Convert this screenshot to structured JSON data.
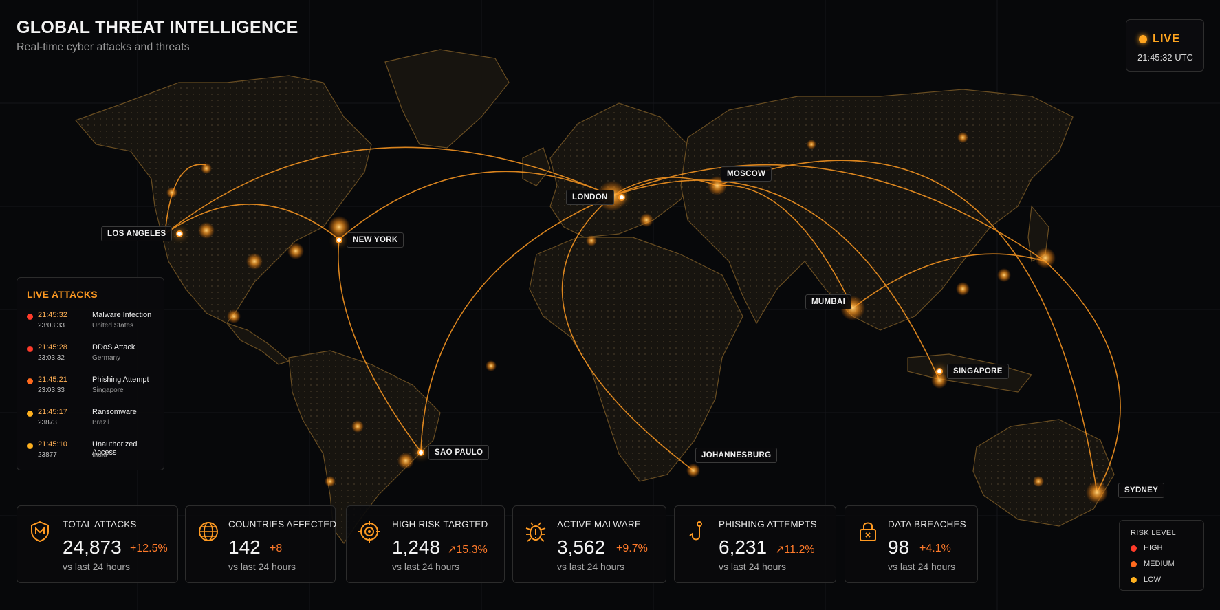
{
  "header": {
    "title": "GLOBAL THREAT INTELLIGENCE",
    "subtitle": "Real-time cyber attacks and threats"
  },
  "status": {
    "label": "LIVE",
    "time": "21:45:32 UTC",
    "color": "#ffa51f"
  },
  "cities": {
    "los_angeles": "LOS ANGELES",
    "new_york": "NEW YORK",
    "london": "LONDON",
    "moscow": "MOSCOW",
    "mumbai": "MUMBAI",
    "singapore": "SINGAPORE",
    "sao_paulo": "SAO PAULO",
    "johannesburg": "JOHANNESBURG",
    "sydney": "SYDNEY"
  },
  "live_attacks": {
    "title": "LIVE ATTACKS",
    "items": [
      {
        "time": "21:45:32",
        "sub": "23:03:33",
        "name": "Malware Infection",
        "location": "United States",
        "color": "#ff3b2a"
      },
      {
        "time": "21:45:28",
        "sub": "23:03:32",
        "name": "DDoS Attack",
        "location": "Germany",
        "color": "#ff3b2a"
      },
      {
        "time": "21:45:21",
        "sub": "23:03:33",
        "name": "Phishing Attempt",
        "location": "Singapore",
        "color": "#ff6a1e"
      },
      {
        "time": "21:45:17",
        "sub": "23873",
        "name": "Ransomware",
        "location": "Brazil",
        "color": "#ffb11f"
      },
      {
        "time": "21:45:10",
        "sub": "23877",
        "name": "Unauthorized Access",
        "location": "India",
        "color": "#ffb11f"
      }
    ]
  },
  "stats": [
    {
      "label": "TOTAL ATTACKS",
      "value": "24,873",
      "change": "+12.5%",
      "note": "vs last 24 hours",
      "icon": "shield-icon"
    },
    {
      "label": "COUNTRIES AFFECTED",
      "value": "142",
      "change": "+8",
      "note": "vs last 24 hours",
      "icon": "globe-icon"
    },
    {
      "label": "HIGH RISK TARGTED",
      "value": "1,248",
      "change": "↗15.3%",
      "note": "vs last 24 hours",
      "icon": "target-icon"
    },
    {
      "label": "ACTIVE MALWARE",
      "value": "3,562",
      "change": "+9.7%",
      "note": "vs last 24 hours",
      "icon": "bug-icon"
    },
    {
      "label": "PHISHING ATTEMPTS",
      "value": "6,231",
      "change": "↗11.2%",
      "note": "vs last 24 hours",
      "icon": "hook-icon"
    },
    {
      "label": "DATA BREACHES",
      "value": "98",
      "change": "+4.1%",
      "note": "vs last 24 hours",
      "icon": "lock-icon"
    }
  ],
  "risk_level": {
    "title": "RISK LEVEL",
    "items": [
      {
        "label": "HIGH",
        "color": "#ff3b2a"
      },
      {
        "label": "MEDIUM",
        "color": "#ff6a1e"
      },
      {
        "label": "LOW",
        "color": "#ffb11f"
      }
    ]
  },
  "colors": {
    "accent": "#ff9a22",
    "change": "#ff7a2a",
    "land": "#1a1712"
  }
}
